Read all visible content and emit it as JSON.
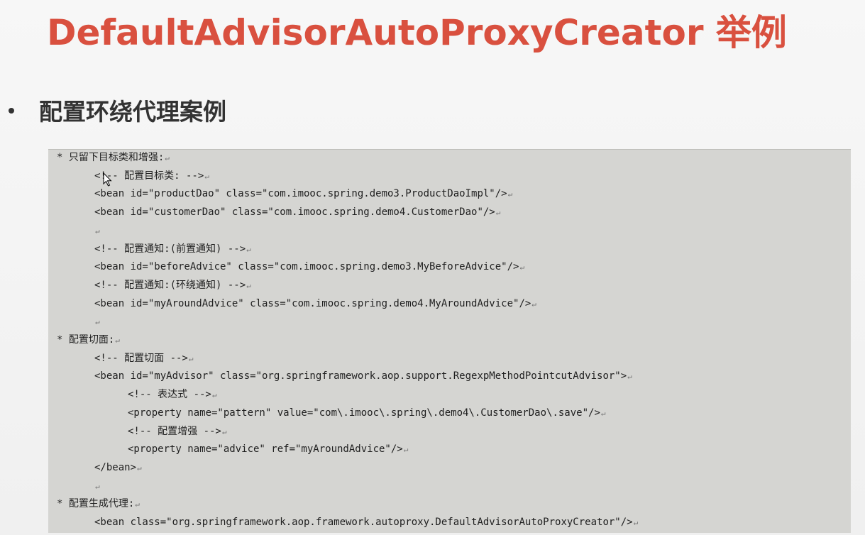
{
  "slide": {
    "title": "DefaultAdvisorAutoProxyCreator 举例",
    "bullet": "配置环绕代理案例"
  },
  "code_block": {
    "paragraph_mark": "↵",
    "lines": [
      {
        "indent": 0,
        "text": "* 只留下目标类和增强:"
      },
      {
        "indent": 1,
        "text": "<!-- 配置目标类: -->"
      },
      {
        "indent": 1,
        "text": "<bean id=\"productDao\" class=\"com.imooc.spring.demo3.ProductDaoImpl\"/>"
      },
      {
        "indent": 1,
        "text": "<bean id=\"customerDao\" class=\"com.imooc.spring.demo4.CustomerDao\"/>"
      },
      {
        "indent": 1,
        "text": ""
      },
      {
        "indent": 1,
        "text": "<!-- 配置通知:(前置通知) -->"
      },
      {
        "indent": 1,
        "text": "<bean id=\"beforeAdvice\" class=\"com.imooc.spring.demo3.MyBeforeAdvice\"/>"
      },
      {
        "indent": 1,
        "text": "<!-- 配置通知:(环绕通知) -->"
      },
      {
        "indent": 1,
        "text": "<bean id=\"myAroundAdvice\" class=\"com.imooc.spring.demo4.MyAroundAdvice\"/>"
      },
      {
        "indent": 1,
        "text": ""
      },
      {
        "indent": 0,
        "text": "* 配置切面:"
      },
      {
        "indent": 1,
        "text": "<!-- 配置切面 -->"
      },
      {
        "indent": 1,
        "text": "<bean id=\"myAdvisor\" class=\"org.springframework.aop.support.RegexpMethodPointcutAdvisor\">"
      },
      {
        "indent": 2,
        "text": "<!-- 表达式 -->"
      },
      {
        "indent": 2,
        "text": "<property name=\"pattern\" value=\"com\\.imooc\\.spring\\.demo4\\.CustomerDao\\.save\"/>"
      },
      {
        "indent": 2,
        "text": "<!-- 配置增强 -->"
      },
      {
        "indent": 2,
        "text": "<property name=\"advice\" ref=\"myAroundAdvice\"/>"
      },
      {
        "indent": 1,
        "text": "</bean>"
      },
      {
        "indent": 1,
        "text": ""
      },
      {
        "indent": 0,
        "text": "* 配置生成代理:"
      },
      {
        "indent": 1,
        "text": "<bean class=\"org.springframework.aop.framework.autoproxy.DefaultAdvisorAutoProxyCreator\"/>"
      }
    ]
  },
  "colors": {
    "title": "#d9503f",
    "text": "#333333",
    "code_bg": "#d5d5d2",
    "code_text": "#1f1f1f"
  }
}
